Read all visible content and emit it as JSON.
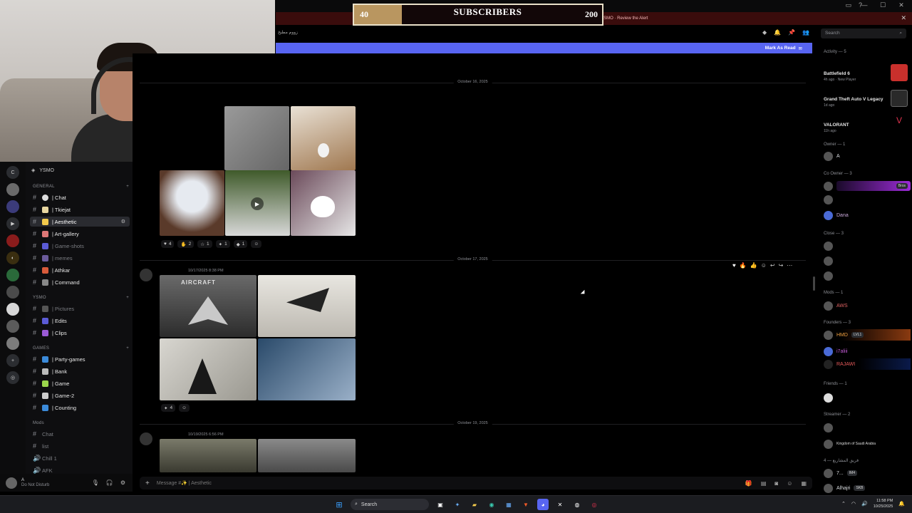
{
  "overlay": {
    "subscribers_title": "SUBSCRIBERS",
    "start": "40",
    "goal": "200",
    "alert_text": "Unusual join activity detected in YSMO · Review the Alert",
    "alert_user": "YSMO"
  },
  "header": {
    "rtl_title": "زووم مطبخ",
    "search_placeholder": "Search",
    "mark_as_read": "Mark As Read"
  },
  "server": {
    "name": "YSMO",
    "categories": [
      {
        "label": "GENERAL",
        "channels": [
          {
            "label": "| Chat",
            "state": "normal"
          },
          {
            "label": "| Tkiejat",
            "state": "normal"
          },
          {
            "label": "| Aesthetic",
            "state": "active"
          },
          {
            "label": "| Art-gallery",
            "state": "normal"
          },
          {
            "label": "| Game-shots",
            "state": "dim"
          },
          {
            "label": "| memes",
            "state": "dim"
          },
          {
            "label": "| Athkar",
            "state": "normal"
          },
          {
            "label": "| Command",
            "state": "normal"
          }
        ]
      },
      {
        "label": "YSMO",
        "channels": [
          {
            "label": "| Pictures",
            "state": "dim"
          },
          {
            "label": "| Edits",
            "state": "normal"
          },
          {
            "label": "| Clips",
            "state": "normal"
          }
        ]
      },
      {
        "label": "GAMES",
        "channels": [
          {
            "label": "| Party-games",
            "state": "normal"
          },
          {
            "label": "| Bank",
            "state": "normal"
          },
          {
            "label": "| Game",
            "state": "normal"
          },
          {
            "label": "| Game-2",
            "state": "normal"
          },
          {
            "label": "| Counting",
            "state": "normal"
          }
        ]
      },
      {
        "label": "Mods",
        "channels": [
          {
            "label": "Chat",
            "state": "dim"
          },
          {
            "label": "list",
            "state": "dim"
          },
          {
            "label": "Chill 1",
            "state": "dim"
          },
          {
            "label": "AFK",
            "state": "dim"
          }
        ]
      }
    ]
  },
  "user": {
    "name": "A",
    "status": "Do Not Disturb"
  },
  "messages": {
    "dates": [
      "October 16, 2025",
      "October 17, 2025",
      "October 19, 2025"
    ],
    "msg2_time": "10/17/2025 8:38 PM",
    "msg3_time": "10/19/2025 6:56 PM",
    "aircraft_caption": "AIRCRAFT",
    "reactions1": [
      {
        "icon": "♥",
        "count": "4"
      },
      {
        "icon": "✋",
        "count": "2"
      },
      {
        "icon": "☆",
        "count": "1"
      },
      {
        "icon": "✦",
        "count": "1"
      },
      {
        "icon": "◆",
        "count": "1"
      }
    ],
    "reactions2": [
      {
        "icon": "✦",
        "count": "4"
      }
    ]
  },
  "composer": {
    "placeholder": "Message #✨ | Aesthetic"
  },
  "members": {
    "activity_head": "Activity — 5",
    "activities": [
      {
        "name": "Battlefield 6",
        "sub": "4h ago · New Player",
        "color": "#c9302c"
      },
      {
        "name": "Grand Theft Auto V Legacy",
        "sub": "1d ago",
        "color": "#2a2a2a"
      },
      {
        "name": "VALORANT",
        "sub": "11h ago",
        "color": "#e0334f"
      }
    ],
    "groups": [
      {
        "head": "Owner — 1",
        "rows": [
          {
            "name": "A",
            "color": "#e6e6e6"
          }
        ]
      },
      {
        "head": "Co Owner — 3",
        "rows": [
          {
            "name": "",
            "color": "#c45bd6",
            "tag": "Bros"
          },
          {
            "name": "",
            "color": "#e6e6e6"
          },
          {
            "name": "Dana",
            "color": "#c9a8d9"
          }
        ]
      },
      {
        "head": "Close — 3",
        "rows": [
          {
            "name": "",
            "color": "#aaa"
          },
          {
            "name": "",
            "color": "#aaa"
          },
          {
            "name": "",
            "color": "#aaa"
          }
        ]
      },
      {
        "head": "Mods — 1",
        "rows": [
          {
            "name": "AWS",
            "color": "#e06363"
          }
        ]
      },
      {
        "head": "Founders — 3",
        "rows": [
          {
            "name": "HMD",
            "color": "#f0a040",
            "tag": "LVL1"
          },
          {
            "name": "i7aliii",
            "color": "#c45bd6"
          },
          {
            "name": "RAJAWI",
            "color": "#e65a5a"
          }
        ]
      },
      {
        "head": "Friends — 1",
        "rows": [
          {
            "name": "",
            "color": "#aaa"
          }
        ]
      },
      {
        "head": "Streamer — 2",
        "rows": [
          {
            "name": "",
            "color": "#8c5bd6"
          },
          {
            "name": "Kingdom of Saudi Arabia",
            "color": "#ddd"
          }
        ]
      },
      {
        "head": "4 — فريق المشاريع",
        "rows": [
          {
            "name": "7...",
            "color": "#ddd",
            "tag": "IM4"
          },
          {
            "name": "Alhajri",
            "color": "#ddd",
            "tag": "SKB"
          }
        ]
      }
    ]
  },
  "taskbar": {
    "search": "Search",
    "time": "11:58 PM",
    "date": "10/25/2025"
  }
}
